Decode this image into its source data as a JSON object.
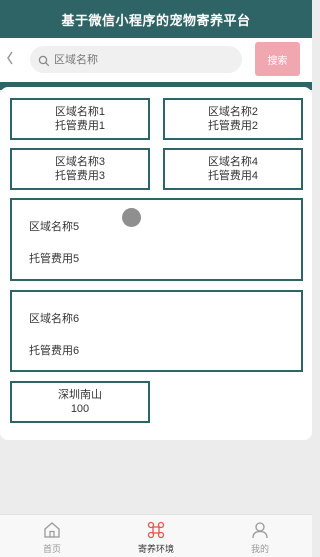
{
  "header": {
    "title": "基于微信小程序的宠物寄养平台"
  },
  "search": {
    "placeholder": "区域名称",
    "button_label": "搜索"
  },
  "areas": [
    {
      "name": "区域名称1",
      "fee": "托管费用1"
    },
    {
      "name": "区域名称2",
      "fee": "托管费用2"
    },
    {
      "name": "区域名称3",
      "fee": "托管费用3"
    },
    {
      "name": "区域名称4",
      "fee": "托管费用4"
    },
    {
      "name": "区域名称5",
      "fee": "托管费用5"
    },
    {
      "name": "区域名称6",
      "fee": "托管费用6"
    },
    {
      "name": "深圳南山",
      "fee": "100"
    }
  ],
  "tabbar": {
    "items": [
      {
        "label": "首页",
        "icon": "home-icon"
      },
      {
        "label": "寄养环境",
        "icon": "environment-icon",
        "active": true
      },
      {
        "label": "我的",
        "icon": "profile-icon"
      }
    ]
  },
  "colors": {
    "primary": "#2f6467",
    "search_button": "#f1a7b0",
    "active_tab_icon": "#e2574c"
  }
}
